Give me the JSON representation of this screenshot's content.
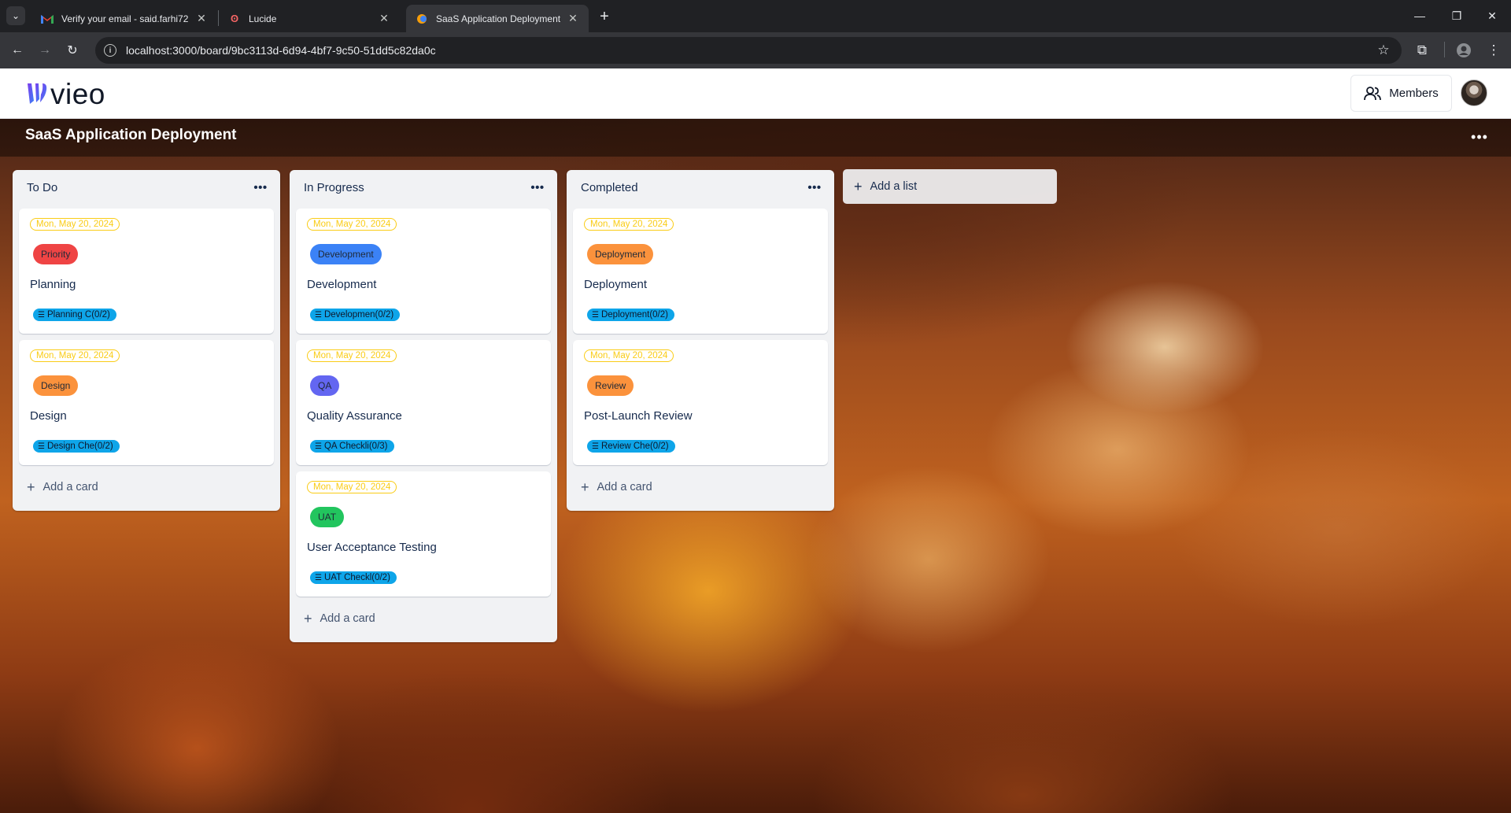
{
  "browser": {
    "tabs": [
      {
        "title": "Verify your email - said.farhi72@",
        "favicon": "gmail-icon",
        "active": false
      },
      {
        "title": "Lucide",
        "favicon": "lucide-icon",
        "active": false
      },
      {
        "title": "SaaS Application Deployment |",
        "favicon": "vieo-icon",
        "active": true
      }
    ],
    "url": "localhost:3000/board/9bc3113d-6d94-4bf7-9c50-51dd5c82da0c"
  },
  "app": {
    "logo_text": "vieo",
    "members_label": "Members",
    "board_title": "SaaS Application Deployment"
  },
  "lists": [
    {
      "title": "To Do",
      "cards": [
        {
          "date": "Mon, May 20, 2024",
          "tag": "Priority",
          "tag_color": "#ef4444",
          "title": "Planning",
          "checklist": "Planning C(0/2)"
        },
        {
          "date": "Mon, May 20, 2024",
          "tag": "Design",
          "tag_color": "#fb923c",
          "title": "Design",
          "checklist": "Design Che(0/2)"
        }
      ],
      "add_card_label": "Add a card"
    },
    {
      "title": "In Progress",
      "cards": [
        {
          "date": "Mon, May 20, 2024",
          "tag": "Development",
          "tag_color": "#3b82f6",
          "title": "Development",
          "checklist": "Developmen(0/2)"
        },
        {
          "date": "Mon, May 20, 2024",
          "tag": "QA",
          "tag_color": "#6366f1",
          "title": "Quality Assurance",
          "checklist": "QA Checkli(0/3)"
        },
        {
          "date": "Mon, May 20, 2024",
          "tag": "UAT",
          "tag_color": "#22c55e",
          "title": "User Acceptance Testing",
          "checklist": "UAT Checkl(0/2)"
        }
      ],
      "add_card_label": "Add a card"
    },
    {
      "title": "Completed",
      "cards": [
        {
          "date": "Mon, May 20, 2024",
          "tag": "Deployment",
          "tag_color": "#fb923c",
          "title": "Deployment",
          "checklist": "Deployment(0/2)"
        },
        {
          "date": "Mon, May 20, 2024",
          "tag": "Review",
          "tag_color": "#fb923c",
          "title": "Post-Launch Review",
          "checklist": "Review Che(0/2)"
        }
      ],
      "add_card_label": "Add a card"
    }
  ],
  "add_list_label": "Add a list"
}
